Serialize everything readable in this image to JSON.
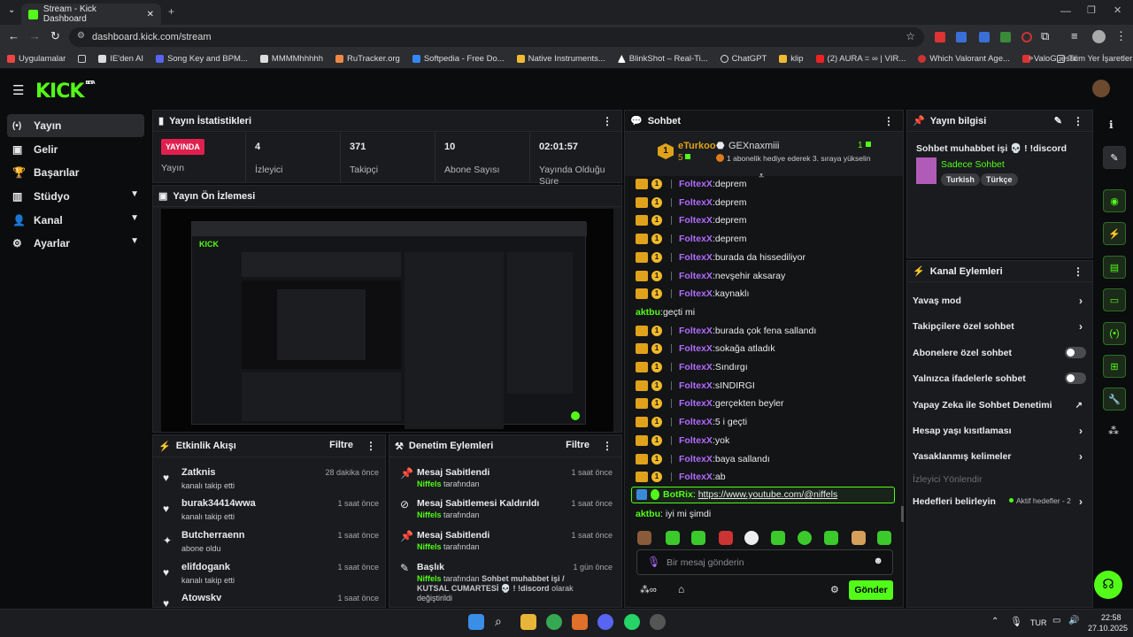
{
  "browser": {
    "tab_title": "Stream - Kick Dashboard",
    "url": "dashboard.kick.com/stream",
    "bookmarks": [
      "Uygulamalar",
      "IE'den AI",
      "Song Key and BPM...",
      "MMMMhhhhh",
      "RuTracker.org",
      "Softpedia - Free Do...",
      "Native Instruments...",
      "BlinkShot – Real-Ti...",
      "ChatGPT",
      "klip",
      "(2) AURA = ∞ | VIR...",
      "Which Valorant Age...",
      "ValoGuessr"
    ],
    "other_bookmarks": "Tüm Yer İşaretleri"
  },
  "kick": {
    "logo": "KICK",
    "beta": "BETA"
  },
  "sidebar": [
    {
      "label": "Yayın",
      "icon": "(•)"
    },
    {
      "label": "Gelir",
      "icon": "▣"
    },
    {
      "label": "Başarılar",
      "icon": "🏆"
    },
    {
      "label": "Stüdyo",
      "icon": "▥"
    },
    {
      "label": "Kanal",
      "icon": "👤"
    },
    {
      "label": "Ayarlar",
      "icon": "⚙"
    }
  ],
  "stats": {
    "title": "Yayın İstatistikleri",
    "live_badge": "YAYINDA",
    "items": [
      {
        "value": "",
        "label": "Yayın"
      },
      {
        "value": "4",
        "label": "İzleyici"
      },
      {
        "value": "371",
        "label": "Takipçi"
      },
      {
        "value": "10",
        "label": "Abone Sayısı"
      },
      {
        "value": "02:01:57",
        "label": "Yayında Olduğu Süre"
      }
    ]
  },
  "preview": {
    "title": "Yayın Ön İzlemesi"
  },
  "activity": {
    "title": "Etkinlik Akışı",
    "filter": "Filtre",
    "items": [
      {
        "name": "Zatknis",
        "sub": "kanalı takip etti",
        "time": "28 dakika önce",
        "icon": "♥"
      },
      {
        "name": "burak34414wwa",
        "sub": "kanalı takip etti",
        "time": "1 saat önce",
        "icon": "♥"
      },
      {
        "name": "Butcherraenn",
        "sub": "abone oldu",
        "time": "1 saat önce",
        "icon": "✦"
      },
      {
        "name": "elifdogank",
        "sub": "kanalı takip etti",
        "time": "1 saat önce",
        "icon": "♥"
      },
      {
        "name": "Atowskv",
        "sub": "",
        "time": "1 saat önce",
        "icon": "♥"
      }
    ]
  },
  "moderation": {
    "title": "Denetim Eylemleri",
    "filter": "Filtre",
    "items": [
      {
        "name": "Mesaj Sabitlendi",
        "user": "Niffels",
        "suffix": "tarafından",
        "time": "1 saat önce",
        "icon": "📌"
      },
      {
        "name": "Mesaj Sabitlemesi Kaldırıldı",
        "user": "Niffels",
        "suffix": "tarafından",
        "time": "1 saat önce",
        "icon": "⊘"
      },
      {
        "name": "Mesaj Sabitlendi",
        "user": "Niffels",
        "suffix": "tarafından",
        "time": "1 saat önce",
        "icon": "📌"
      },
      {
        "name": "Başlık",
        "user": "Niffels",
        "suffix": "tarafından",
        "extra": "Sohbet muhabbet işi / KUTSAL CUMARTESİ 💀 ! !discord",
        "extra2": "olarak değiştirildi",
        "time": "1 gün önce",
        "icon": "✎"
      }
    ]
  },
  "chat": {
    "title": "Sohbet",
    "top_gifter": {
      "rank": "1",
      "name": "eTurkoo",
      "count": "5"
    },
    "gift": {
      "name": "GEXnaxmiii",
      "count": "1",
      "text": "1 abonelik hediye ederek 3. sıraya yükselin"
    },
    "messages": [
      {
        "user": "FoltexX",
        "text": "deprem",
        "badges": true
      },
      {
        "user": "FoltexX",
        "text": "deprem",
        "badges": true
      },
      {
        "user": "FoltexX",
        "text": "deprem",
        "badges": true
      },
      {
        "user": "FoltexX",
        "text": "deprem",
        "badges": true
      },
      {
        "user": "FoltexX",
        "text": "burada da hissediliyor",
        "badges": true
      },
      {
        "user": "FoltexX",
        "text": "nevşehir aksaray",
        "badges": true
      },
      {
        "user": "FoltexX",
        "text": "kaynaklı",
        "badges": true
      },
      {
        "user": "aktbu",
        "text": "geçti mi",
        "badges": false
      },
      {
        "user": "FoltexX",
        "text": "burada çok fena sallandı",
        "badges": true
      },
      {
        "user": "FoltexX",
        "text": "sokağa atladık",
        "badges": true
      },
      {
        "user": "FoltexX",
        "text": "Sındırgı",
        "badges": true
      },
      {
        "user": "FoltexX",
        "text": "sINDIRGI",
        "badges": true
      },
      {
        "user": "FoltexX",
        "text": "gerçekten beyler",
        "badges": true
      },
      {
        "user": "FoltexX",
        "text": "5 i geçti",
        "badges": true
      },
      {
        "user": "FoltexX",
        "text": "yok",
        "badges": true
      },
      {
        "user": "FoltexX",
        "text": "baya sallandı",
        "badges": true
      },
      {
        "user": "FoltexX",
        "text": "ab",
        "badges": true
      }
    ],
    "bot": {
      "user": "BotRix",
      "text": "https://www.youtube.com/@niffels"
    },
    "last": {
      "user": "aktbu",
      "text": "iyi mi şimdi"
    },
    "placeholder": "Bir mesaj gönderin",
    "send": "Gönder"
  },
  "info": {
    "title": "Yayın bilgisi",
    "stream_title": "Sohbet muhabbet işi 💀 ! !discord",
    "category": "Sadece Sohbet",
    "tags": [
      "Turkish",
      "Türkçe"
    ]
  },
  "channel_actions": {
    "title": "Kanal Eylemleri",
    "items": [
      "Yavaş mod",
      "Takipçilere özel sohbet",
      "Abonelere özel sohbet",
      "Yalnızca ifadelerle sohbet",
      "Yapay Zeka ile Sohbet Denetimi",
      "Hesap yaşı kısıtlaması",
      "Yasaklanmış kelimeler",
      "İzleyici Yönlendir",
      "Hedefleri belirleyin"
    ],
    "goal_status": "Aktif hedefler - 2"
  },
  "taskbar": {
    "lang": "TUR",
    "time": "22:58",
    "date": "27.10.2025"
  },
  "colors": {
    "accent": "#53fc18",
    "live": "#e0204f",
    "username": "#b06cff"
  }
}
